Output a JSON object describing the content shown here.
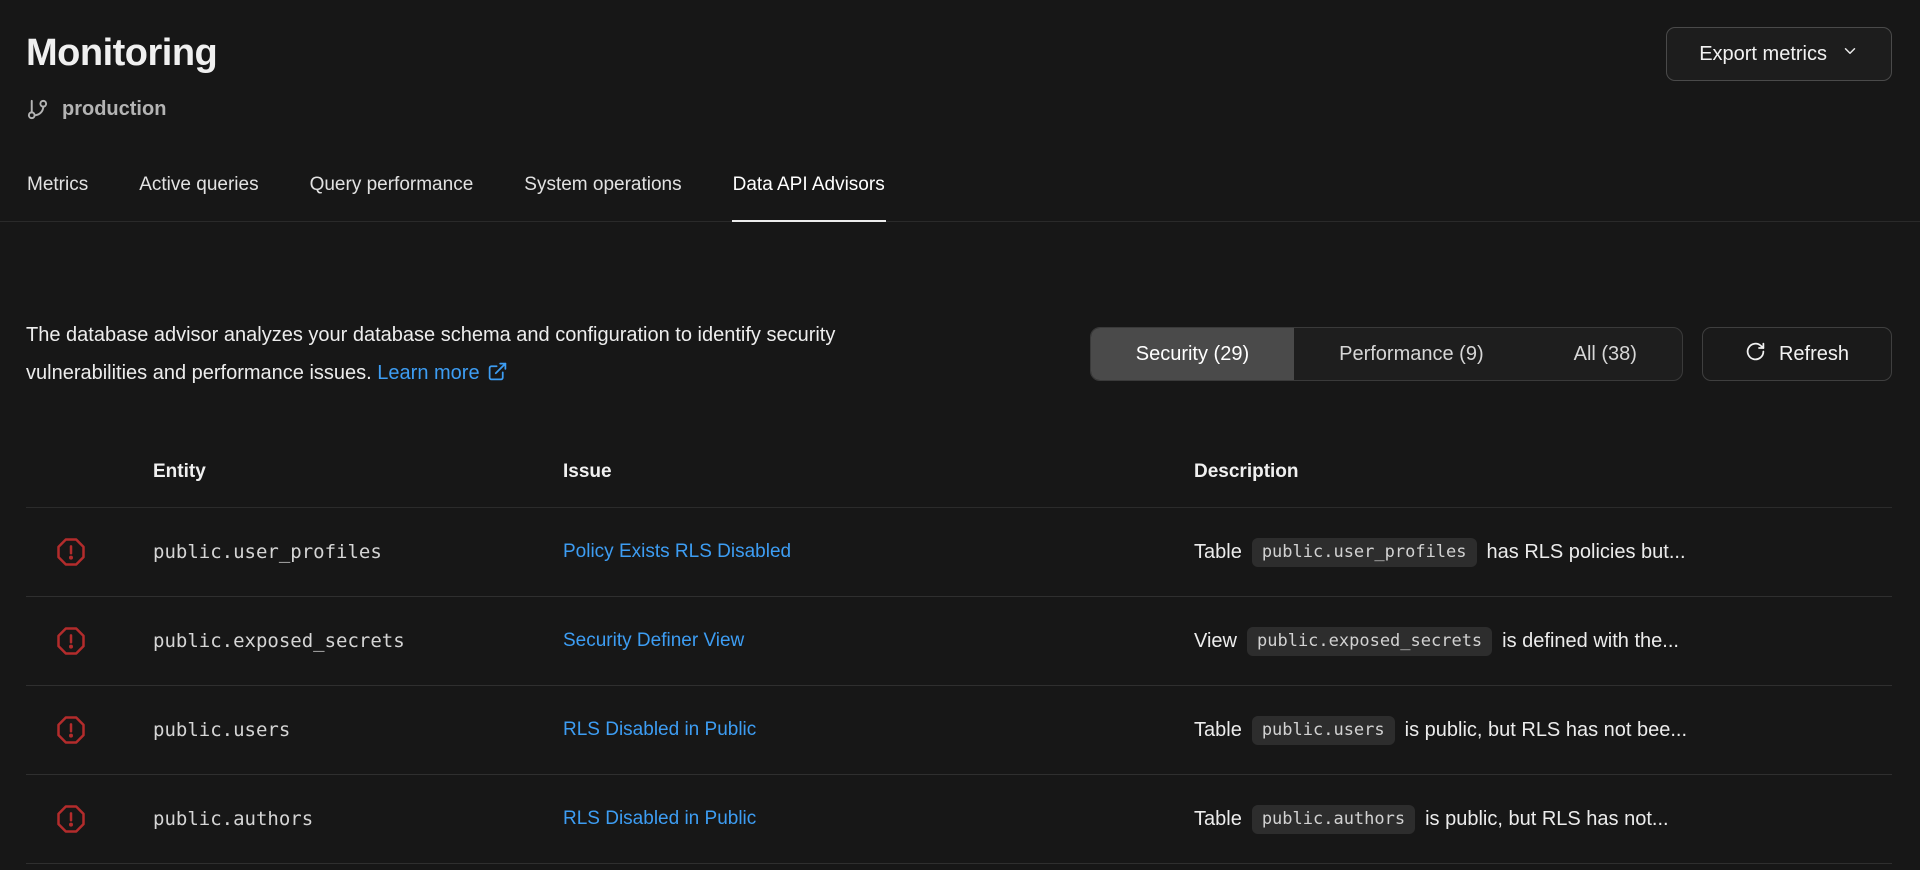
{
  "header": {
    "title": "Monitoring",
    "environment": "production",
    "export_button": "Export metrics"
  },
  "tabs": [
    {
      "label": "Metrics",
      "active": false
    },
    {
      "label": "Active queries",
      "active": false
    },
    {
      "label": "Query performance",
      "active": false
    },
    {
      "label": "System operations",
      "active": false
    },
    {
      "label": "Data API Advisors",
      "active": true
    }
  ],
  "advisor": {
    "description_text": "The database advisor analyzes your database schema and configuration to identify security vulnerabilities and performance issues.",
    "learn_more": "Learn more",
    "filters": [
      {
        "label": "Security (29)",
        "active": true
      },
      {
        "label": "Performance (9)",
        "active": false
      },
      {
        "label": "All (38)",
        "active": false
      }
    ],
    "refresh_label": "Refresh"
  },
  "table": {
    "columns": [
      "Entity",
      "Issue",
      "Description"
    ],
    "rows": [
      {
        "entity": "public.user_profiles",
        "issue": "Policy Exists RLS Disabled",
        "desc_prefix": "Table",
        "desc_code": "public.user_profiles",
        "desc_suffix": "has RLS policies but..."
      },
      {
        "entity": "public.exposed_secrets",
        "issue": "Security Definer View",
        "desc_prefix": "View",
        "desc_code": "public.exposed_secrets",
        "desc_suffix": "is defined with the..."
      },
      {
        "entity": "public.users",
        "issue": "RLS Disabled in Public",
        "desc_prefix": "Table",
        "desc_code": "public.users",
        "desc_suffix": "is public, but RLS has not bee..."
      },
      {
        "entity": "public.authors",
        "issue": "RLS Disabled in Public",
        "desc_prefix": "Table",
        "desc_code": "public.authors",
        "desc_suffix": "is public, but RLS has not..."
      }
    ]
  },
  "colors": {
    "background": "#171717",
    "link_blue": "#3d9df3",
    "warning_red": "#b32c2c",
    "chip_bg": "#2d2d2d",
    "active_segment_bg": "#4a4a4a"
  }
}
